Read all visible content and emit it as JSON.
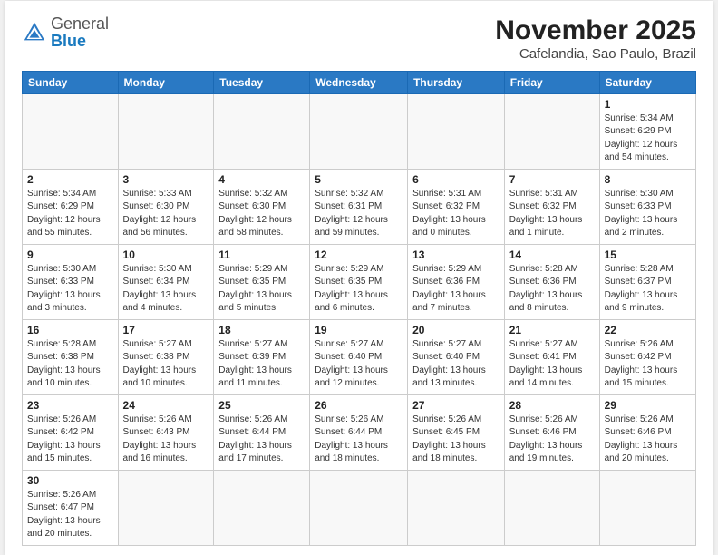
{
  "header": {
    "logo_general": "General",
    "logo_blue": "Blue",
    "month": "November 2025",
    "location": "Cafelandia, Sao Paulo, Brazil"
  },
  "days_of_week": [
    "Sunday",
    "Monday",
    "Tuesday",
    "Wednesday",
    "Thursday",
    "Friday",
    "Saturday"
  ],
  "weeks": [
    [
      {
        "day": "",
        "info": ""
      },
      {
        "day": "",
        "info": ""
      },
      {
        "day": "",
        "info": ""
      },
      {
        "day": "",
        "info": ""
      },
      {
        "day": "",
        "info": ""
      },
      {
        "day": "",
        "info": ""
      },
      {
        "day": "1",
        "info": "Sunrise: 5:34 AM\nSunset: 6:29 PM\nDaylight: 12 hours\nand 54 minutes."
      }
    ],
    [
      {
        "day": "2",
        "info": "Sunrise: 5:34 AM\nSunset: 6:29 PM\nDaylight: 12 hours\nand 55 minutes."
      },
      {
        "day": "3",
        "info": "Sunrise: 5:33 AM\nSunset: 6:30 PM\nDaylight: 12 hours\nand 56 minutes."
      },
      {
        "day": "4",
        "info": "Sunrise: 5:32 AM\nSunset: 6:30 PM\nDaylight: 12 hours\nand 58 minutes."
      },
      {
        "day": "5",
        "info": "Sunrise: 5:32 AM\nSunset: 6:31 PM\nDaylight: 12 hours\nand 59 minutes."
      },
      {
        "day": "6",
        "info": "Sunrise: 5:31 AM\nSunset: 6:32 PM\nDaylight: 13 hours\nand 0 minutes."
      },
      {
        "day": "7",
        "info": "Sunrise: 5:31 AM\nSunset: 6:32 PM\nDaylight: 13 hours\nand 1 minute."
      },
      {
        "day": "8",
        "info": "Sunrise: 5:30 AM\nSunset: 6:33 PM\nDaylight: 13 hours\nand 2 minutes."
      }
    ],
    [
      {
        "day": "9",
        "info": "Sunrise: 5:30 AM\nSunset: 6:33 PM\nDaylight: 13 hours\nand 3 minutes."
      },
      {
        "day": "10",
        "info": "Sunrise: 5:30 AM\nSunset: 6:34 PM\nDaylight: 13 hours\nand 4 minutes."
      },
      {
        "day": "11",
        "info": "Sunrise: 5:29 AM\nSunset: 6:35 PM\nDaylight: 13 hours\nand 5 minutes."
      },
      {
        "day": "12",
        "info": "Sunrise: 5:29 AM\nSunset: 6:35 PM\nDaylight: 13 hours\nand 6 minutes."
      },
      {
        "day": "13",
        "info": "Sunrise: 5:29 AM\nSunset: 6:36 PM\nDaylight: 13 hours\nand 7 minutes."
      },
      {
        "day": "14",
        "info": "Sunrise: 5:28 AM\nSunset: 6:36 PM\nDaylight: 13 hours\nand 8 minutes."
      },
      {
        "day": "15",
        "info": "Sunrise: 5:28 AM\nSunset: 6:37 PM\nDaylight: 13 hours\nand 9 minutes."
      }
    ],
    [
      {
        "day": "16",
        "info": "Sunrise: 5:28 AM\nSunset: 6:38 PM\nDaylight: 13 hours\nand 10 minutes."
      },
      {
        "day": "17",
        "info": "Sunrise: 5:27 AM\nSunset: 6:38 PM\nDaylight: 13 hours\nand 10 minutes."
      },
      {
        "day": "18",
        "info": "Sunrise: 5:27 AM\nSunset: 6:39 PM\nDaylight: 13 hours\nand 11 minutes."
      },
      {
        "day": "19",
        "info": "Sunrise: 5:27 AM\nSunset: 6:40 PM\nDaylight: 13 hours\nand 12 minutes."
      },
      {
        "day": "20",
        "info": "Sunrise: 5:27 AM\nSunset: 6:40 PM\nDaylight: 13 hours\nand 13 minutes."
      },
      {
        "day": "21",
        "info": "Sunrise: 5:27 AM\nSunset: 6:41 PM\nDaylight: 13 hours\nand 14 minutes."
      },
      {
        "day": "22",
        "info": "Sunrise: 5:26 AM\nSunset: 6:42 PM\nDaylight: 13 hours\nand 15 minutes."
      }
    ],
    [
      {
        "day": "23",
        "info": "Sunrise: 5:26 AM\nSunset: 6:42 PM\nDaylight: 13 hours\nand 15 minutes."
      },
      {
        "day": "24",
        "info": "Sunrise: 5:26 AM\nSunset: 6:43 PM\nDaylight: 13 hours\nand 16 minutes."
      },
      {
        "day": "25",
        "info": "Sunrise: 5:26 AM\nSunset: 6:44 PM\nDaylight: 13 hours\nand 17 minutes."
      },
      {
        "day": "26",
        "info": "Sunrise: 5:26 AM\nSunset: 6:44 PM\nDaylight: 13 hours\nand 18 minutes."
      },
      {
        "day": "27",
        "info": "Sunrise: 5:26 AM\nSunset: 6:45 PM\nDaylight: 13 hours\nand 18 minutes."
      },
      {
        "day": "28",
        "info": "Sunrise: 5:26 AM\nSunset: 6:46 PM\nDaylight: 13 hours\nand 19 minutes."
      },
      {
        "day": "29",
        "info": "Sunrise: 5:26 AM\nSunset: 6:46 PM\nDaylight: 13 hours\nand 20 minutes."
      }
    ],
    [
      {
        "day": "30",
        "info": "Sunrise: 5:26 AM\nSunset: 6:47 PM\nDaylight: 13 hours\nand 20 minutes."
      },
      {
        "day": "",
        "info": ""
      },
      {
        "day": "",
        "info": ""
      },
      {
        "day": "",
        "info": ""
      },
      {
        "day": "",
        "info": ""
      },
      {
        "day": "",
        "info": ""
      },
      {
        "day": "",
        "info": ""
      }
    ]
  ]
}
